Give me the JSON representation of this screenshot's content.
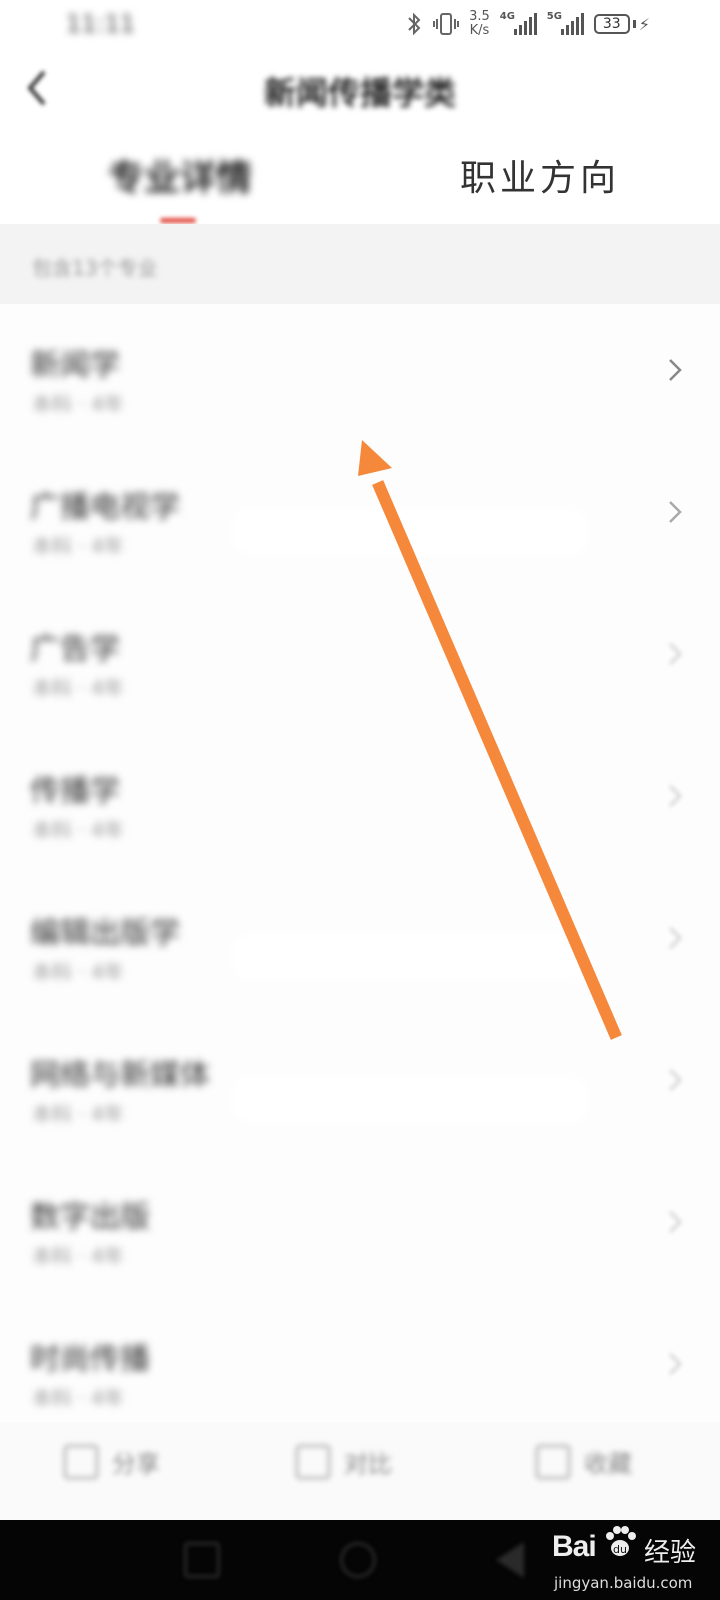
{
  "status_bar": {
    "time": "11:11",
    "net_speed_value": "3.5",
    "net_speed_unit": "K/s",
    "sim1_type": "4G",
    "sim2_type": "5G",
    "battery": "33"
  },
  "header": {
    "title": "新闻传播学类",
    "back_icon": "chevron-left-icon"
  },
  "tabs": [
    {
      "label": "专业详情"
    },
    {
      "label": "职业方向"
    }
  ],
  "subheader": {
    "text": "包含13个专业"
  },
  "list": {
    "items": [
      {
        "name": "新闻学",
        "meta": "本科 · 4年"
      },
      {
        "name": "广播电视学",
        "meta": "本科 · 4年"
      },
      {
        "name": "广告学",
        "meta": "本科 · 4年"
      },
      {
        "name": "传播学",
        "meta": "本科 · 4年"
      },
      {
        "name": "编辑出版学",
        "meta": "本科 · 4年"
      },
      {
        "name": "网络与新媒体",
        "meta": "本科 · 4年"
      },
      {
        "name": "数字出版",
        "meta": "本科 · 4年"
      },
      {
        "name": "时尚传播",
        "meta": "本科 · 4年"
      }
    ]
  },
  "bottom_bar": {
    "items": [
      {
        "label": "分享",
        "icon": "share-icon"
      },
      {
        "label": "对比",
        "icon": "compare-icon"
      },
      {
        "label": "收藏",
        "icon": "bookmark-icon"
      }
    ]
  },
  "watermark": {
    "logo_text": "Bai",
    "logo_cn": "经验",
    "url": "jingyan.baidu.com"
  },
  "annotation": {
    "arrow_color": "#f5883a"
  }
}
